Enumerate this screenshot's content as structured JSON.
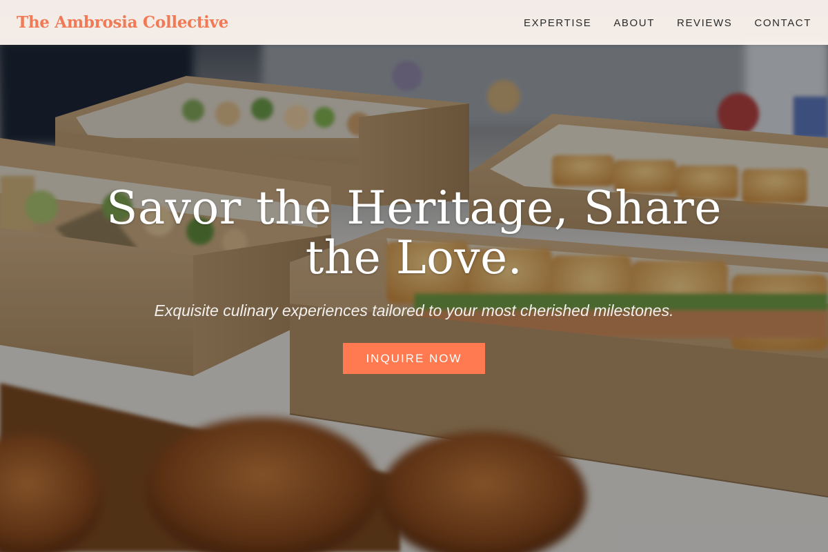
{
  "brand": {
    "name": "The Ambrosia Collective",
    "color": "#f07a56"
  },
  "nav": {
    "items": [
      {
        "label": "EXPERTISE"
      },
      {
        "label": "ABOUT"
      },
      {
        "label": "REVIEWS"
      },
      {
        "label": "CONTACT"
      }
    ]
  },
  "hero": {
    "headline": "Savor the Heritage, Share the Love.",
    "subheadline": "Exquisite culinary experiences tailored to your most cherished milestones.",
    "cta_label": "INQUIRE NOW",
    "cta_color": "#ff7a50",
    "background_image": "catered-food-boxes-photo"
  }
}
